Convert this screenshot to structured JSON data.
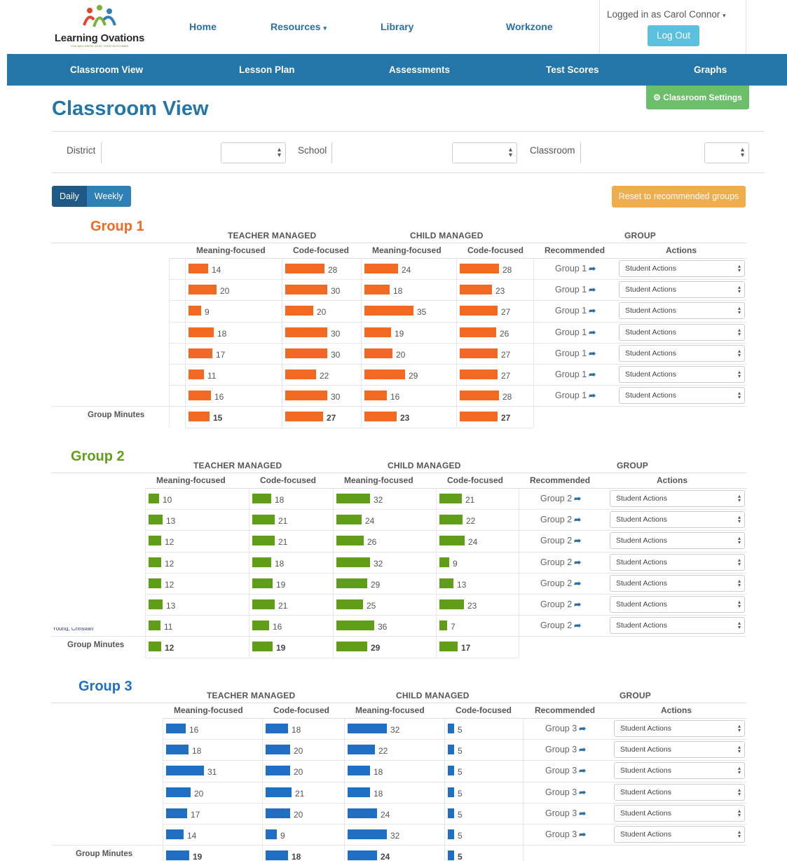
{
  "brand": {
    "name": "Learning Ovations",
    "tagline": "YOU WILL KNOW US BY YOUR OUTCOMES"
  },
  "topnav": {
    "home": "Home",
    "resources": "Resources",
    "library": "Library",
    "workzone": "Workzone"
  },
  "user": {
    "logged_in_text": "Logged in as Carol Connor",
    "logout": "Log Out"
  },
  "mainnav": {
    "classroom_view": "Classroom View",
    "lesson_plan": "Lesson Plan",
    "assessments": "Assessments",
    "test_scores": "Test Scores",
    "graphs": "Graphs"
  },
  "settings_button": "Classroom Settings",
  "page_title": "Classroom View",
  "filters": {
    "district": "District",
    "school": "School",
    "classroom": "Classroom"
  },
  "view_toggle": {
    "daily": "Daily",
    "weekly": "Weekly"
  },
  "reset_button": "Reset to recommended groups",
  "headers": {
    "teacher_managed": "TEACHER MANAGED",
    "child_managed": "CHILD MANAGED",
    "group": "GROUP",
    "meaning_focused": "Meaning-focused",
    "code_focused": "Code-focused",
    "recommended": "Recommended",
    "actions": "Actions",
    "group_minutes": "Group Minutes",
    "student_actions": "Student Actions"
  },
  "colors": {
    "group1": "#f26a21",
    "group2": "#5f9e16",
    "group3": "#1f6fc5",
    "navbar": "#2475a8"
  },
  "groups": [
    {
      "title": "Group 1",
      "recommended_label": "Group 1",
      "rows": [
        [
          14,
          28,
          24,
          28
        ],
        [
          20,
          30,
          18,
          23
        ],
        [
          9,
          20,
          35,
          27
        ],
        [
          18,
          30,
          19,
          26
        ],
        [
          17,
          30,
          20,
          27
        ],
        [
          11,
          22,
          29,
          27
        ],
        [
          16,
          30,
          16,
          28
        ]
      ],
      "group_minutes": [
        15,
        27,
        23,
        27
      ]
    },
    {
      "title": "Group 2",
      "recommended_label": "Group 2",
      "partial_student_label": "Young, Christian",
      "rows": [
        [
          10,
          18,
          32,
          21
        ],
        [
          13,
          21,
          24,
          22
        ],
        [
          12,
          21,
          26,
          24
        ],
        [
          12,
          18,
          32,
          9
        ],
        [
          12,
          19,
          29,
          13
        ],
        [
          13,
          21,
          25,
          23
        ],
        [
          11,
          16,
          36,
          7
        ]
      ],
      "group_minutes": [
        12,
        19,
        29,
        17
      ]
    },
    {
      "title": "Group 3",
      "recommended_label": "Group 3",
      "rows": [
        [
          16,
          18,
          32,
          5
        ],
        [
          18,
          20,
          22,
          5
        ],
        [
          31,
          20,
          18,
          5
        ],
        [
          20,
          21,
          18,
          5
        ],
        [
          17,
          20,
          24,
          5
        ],
        [
          14,
          9,
          32,
          5
        ]
      ],
      "group_minutes": [
        19,
        18,
        24,
        5
      ]
    }
  ]
}
